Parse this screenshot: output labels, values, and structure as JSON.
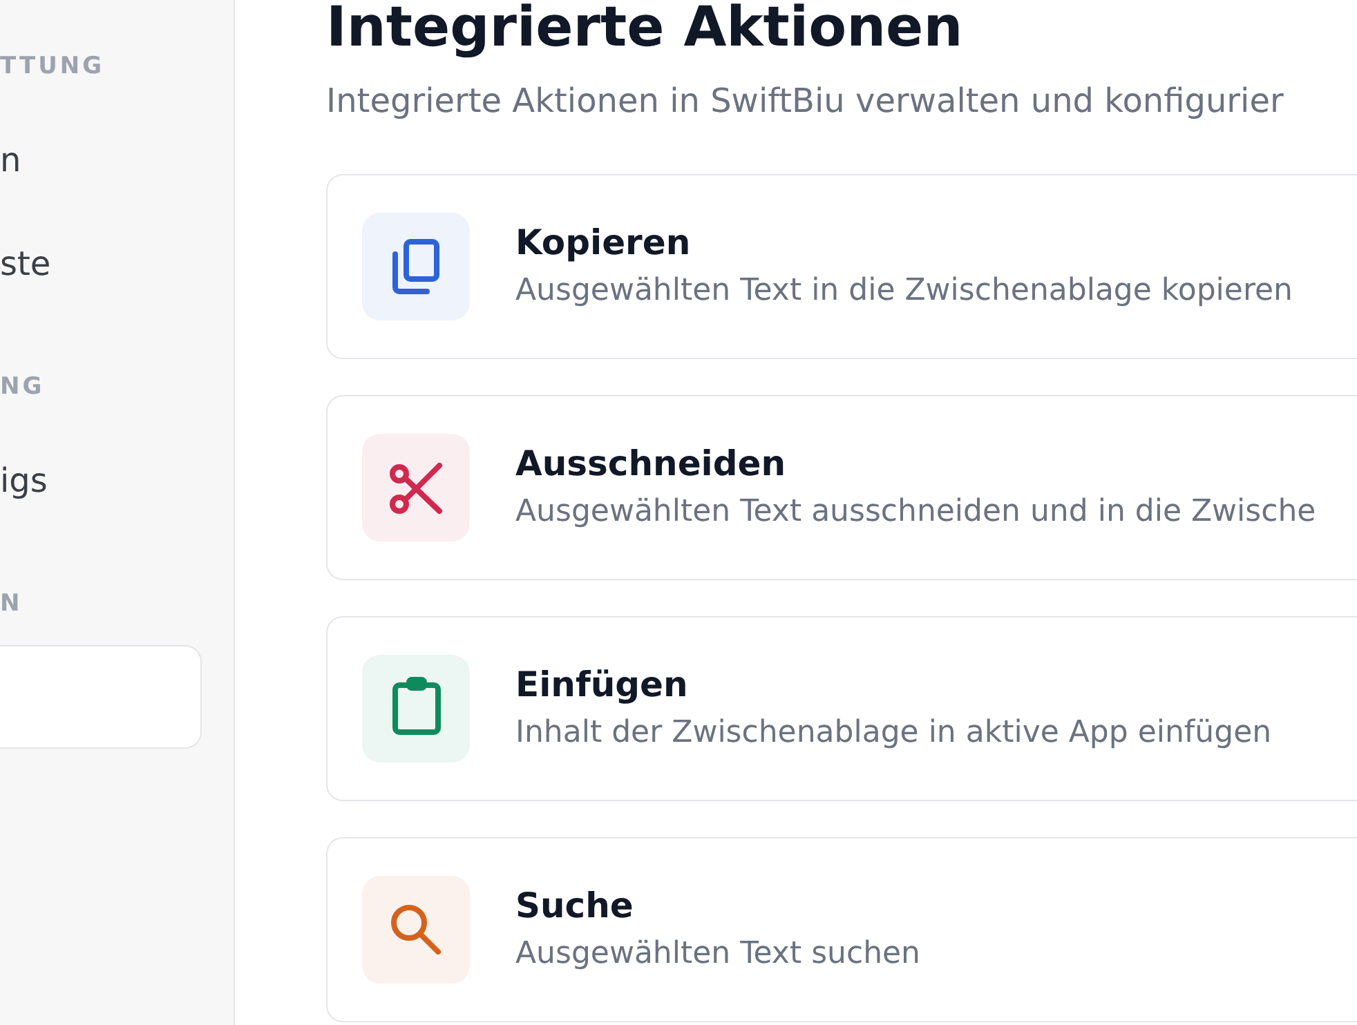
{
  "sidebar": {
    "sections": [
      {
        "header": "TTUNG",
        "items": [
          {
            "label": "n",
            "selected": false
          },
          {
            "label": "ste",
            "selected": false
          }
        ]
      },
      {
        "header": "NG",
        "items": [
          {
            "label": "igs",
            "selected": false
          }
        ]
      },
      {
        "header": "N",
        "items": [
          {
            "selected": true
          }
        ]
      }
    ]
  },
  "page": {
    "title": "Integrierte Aktionen",
    "subtitle": "Integrierte Aktionen in SwiftBiu verwalten und konfigurier"
  },
  "actions": [
    {
      "title": "Kopieren",
      "description": "Ausgewählten Text in die Zwischenablage kopieren",
      "color": "#2c64d8"
    },
    {
      "title": "Ausschneiden",
      "description": "Ausgewählten Text ausschneiden und in die Zwische",
      "color": "#d0284f"
    },
    {
      "title": "Einfügen",
      "description": "Inhalt der Zwischenablage in aktive App einfügen",
      "color": "#0f8a5f"
    },
    {
      "title": "Suche",
      "description": "Ausgewählten Text suchen",
      "color": "#d4621c"
    }
  ]
}
